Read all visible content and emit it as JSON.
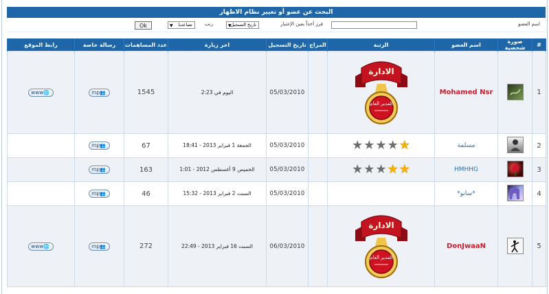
{
  "search": {
    "title": "البحث عن عضو أو تغيير نظام الاظهار",
    "member_label": "اسم العضو",
    "member_value": "",
    "sort_label": "فرز أخذاً بعين الإعتبار",
    "sort_select": "تاريخ التسجيل",
    "order_label": "رتب",
    "order_select": "تصاعديا",
    "ok": "Ok"
  },
  "columns": [
    "#",
    "صورة شخصية",
    "اسم العضو",
    "الرتبة",
    "المزاج",
    "تاريخ التسجيل",
    "اخر زيارة",
    "عدد المساهمات",
    "رسالة خاصة",
    "رابط الموقع"
  ],
  "rows": [
    {
      "index": "1",
      "avatar": "avatar-1",
      "name": "Mohamed Nsr",
      "name_style": "admin",
      "rank_title": "الادارة",
      "rank_sub": "المدير العام",
      "stars": 0,
      "joined": "05/03/2010",
      "last_visit": "اليوم في 2:23",
      "posts": "1545",
      "pm": "mp",
      "www": "www"
    },
    {
      "index": "2",
      "avatar": "avatar-2",
      "name": "مسلمة",
      "name_style": "normal",
      "rank_title": "",
      "rank_sub": "",
      "stars": 1,
      "joined": "05/03/2010",
      "last_visit": "الجمعة 1 فبراير 2013 - 18:41",
      "posts": "67",
      "pm": "mp",
      "www": ""
    },
    {
      "index": "3",
      "avatar": "avatar-3",
      "name": "HMHHG",
      "name_style": "normal",
      "rank_title": "",
      "rank_sub": "",
      "stars": 2,
      "joined": "05/03/2010",
      "last_visit": "الخميس 9 أغسطس 2012 - 1:01",
      "posts": "163",
      "pm": "mp",
      "www": ""
    },
    {
      "index": "4",
      "avatar": "avatar-4",
      "name": "*سانو*",
      "name_style": "normal",
      "rank_title": "",
      "rank_sub": "",
      "stars": 0,
      "joined": "05/03/2010",
      "last_visit": "السبت 2 فبراير 2013 - 15:32",
      "posts": "46",
      "pm": "mp",
      "www": ""
    },
    {
      "index": "5",
      "avatar": "avatar-5",
      "name": "DonJwaaN",
      "name_style": "admin",
      "rank_title": "الادارة",
      "rank_sub": "المدير العام",
      "stars": 0,
      "joined": "06/03/2010",
      "last_visit": "السبت 16 فبراير 2013 - 22:49",
      "posts": "272",
      "pm": "mp",
      "www": "www"
    }
  ],
  "colors": {
    "header_blue": "#1f66a8",
    "admin_name": "#c41f2f",
    "normal_name": "#2b6ea6",
    "ribbon_red": "#b5121b",
    "gold": "#f6b100"
  }
}
